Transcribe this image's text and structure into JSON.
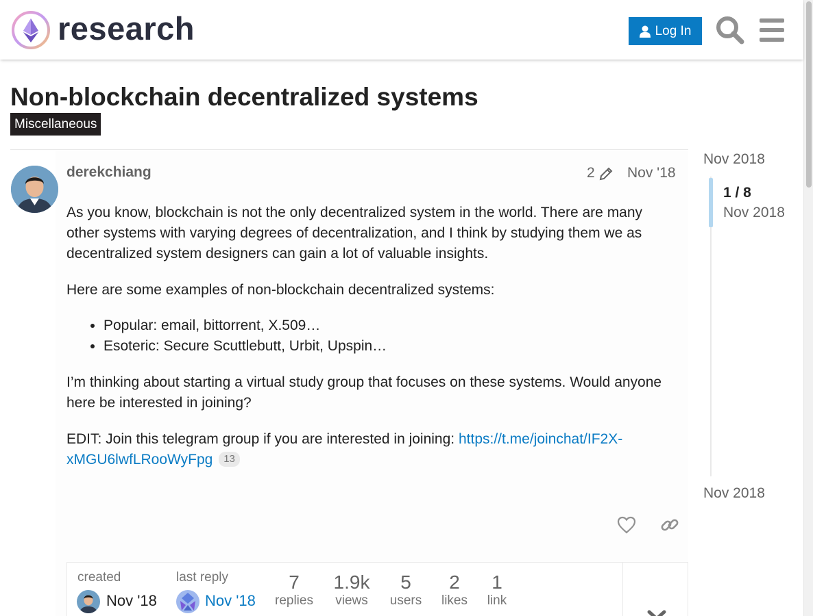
{
  "header": {
    "logo_icon": "ethereum-research-logo",
    "site_name": "research",
    "login_label": "Log In",
    "search_icon": "search-icon",
    "menu_icon": "hamburger-menu-icon"
  },
  "topic": {
    "title": "Non-blockchain decentralized systems",
    "category": "Miscellaneous"
  },
  "post": {
    "username": "derekchiang",
    "edit_count": "2",
    "date": "Nov '18",
    "paragraph1": "As you know, blockchain is not the only decentralized system in the world. There are many other systems with varying degrees of decentralization, and I think by studying them we as decentralized system designers can gain a lot of valuable insights.",
    "paragraph2": "Here are some examples of non-blockchain decentralized systems:",
    "list": [
      "Popular: email, bittorrent, X.509…",
      "Esoteric: Secure Scuttlebutt, Urbit, Upspin…"
    ],
    "paragraph3": "I’m thinking about starting a virtual study group that focuses on these systems. Would anyone here be interested in joining?",
    "edit_prefix": "EDIT: Join this telegram group if you are interested in joining: ",
    "edit_link": "https://t.me/joinchat/IF2X-xMGU6lwfLRooWyFpg",
    "link_clicks": "13"
  },
  "topic_map": {
    "created_label": "created",
    "created_date": "Nov '18",
    "last_reply_label": "last reply",
    "last_reply_date": "Nov '18",
    "stats": [
      {
        "num": "7",
        "label": "replies"
      },
      {
        "num": "1.9k",
        "label": "views"
      },
      {
        "num": "5",
        "label": "users"
      },
      {
        "num": "2",
        "label": "likes"
      },
      {
        "num": "1",
        "label": "link"
      }
    ]
  },
  "timeline": {
    "start": "Nov 2018",
    "position": "1 / 8",
    "position_date": "Nov 2018",
    "end": "Nov 2018"
  },
  "colors": {
    "accent": "#0a7bc4",
    "category_bg": "#231f20",
    "timeline_handle": "#b3d7f0"
  }
}
